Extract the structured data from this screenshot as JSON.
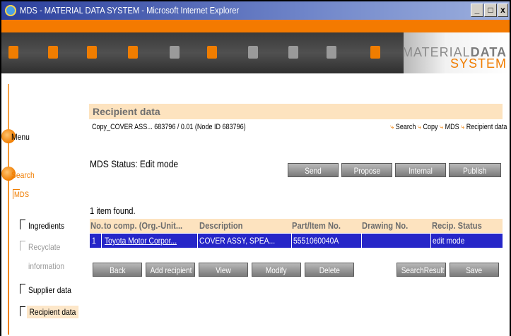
{
  "window": {
    "title": "MDS - MATERIAL DATA SYSTEM - Microsoft Internet Explorer",
    "controls": {
      "minimize": "_",
      "restore": "□",
      "close": "x"
    }
  },
  "toolbar": {
    "icons": [
      {
        "name": "home-icon",
        "color": "#f07d00"
      },
      {
        "name": "check-icon",
        "color": "#f07d00"
      },
      {
        "name": "search-icon",
        "color": "#f07d00"
      },
      {
        "name": "globe-icon",
        "color": "#f07d00"
      },
      {
        "name": "pen-icon",
        "color": "#9a9a9a"
      },
      {
        "name": "flask-icon",
        "color": "#f07d00"
      },
      {
        "name": "document-icon",
        "color": "#9a9a9a"
      },
      {
        "name": "notes-icon",
        "color": "#9a9a9a"
      },
      {
        "name": "print-icon",
        "color": "#9a9a9a"
      },
      {
        "name": "help-icon",
        "color": "#f07d00"
      }
    ],
    "brand_line1_a": "MATERIAL",
    "brand_line1_b": "DATA",
    "brand_line2": "SYSTEM"
  },
  "sidebar": {
    "menu": "Menu",
    "search": "Search",
    "mds": "MDS",
    "items": [
      {
        "label": "Ingredients",
        "state": "enabled"
      },
      {
        "label": "Recyclate",
        "state": "disabled"
      },
      {
        "label": "information",
        "state": "disabled"
      },
      {
        "label": "Supplier data",
        "state": "enabled"
      },
      {
        "label": "Recipient data",
        "state": "active"
      }
    ]
  },
  "main": {
    "section_title": "Recipient data",
    "node_info": "Copy_COVER ASS... 683796 / 0.01 (Node ID 683796)",
    "breadcrumbs": [
      "Search",
      "Copy",
      "MDS",
      "Recipient data"
    ],
    "status_text": "MDS Status: Edit mode",
    "status_buttons": [
      "Send",
      "Propose",
      "Internal",
      "Publish"
    ],
    "found_text": "1 item found.",
    "table": {
      "headers": [
        "No.",
        "to comp. (Org.-Unit...",
        "Description",
        "Part/Item No.",
        "Drawing No.",
        "Recip. Status"
      ],
      "rows": [
        [
          "1",
          "Toyota Motor Corpor...",
          "COVER ASSY, SPEA...",
          "5551060040A",
          "",
          "edit mode"
        ]
      ]
    },
    "action_buttons": [
      "Back",
      "Add recipient",
      "View",
      "Modify",
      "Delete",
      "SearchResult",
      "Save"
    ]
  },
  "colors": {
    "accent_orange": "#f07d00",
    "header_peach": "#fde3bf",
    "selected_row": "#2626c8",
    "button_gray": "#8c8c8c"
  }
}
